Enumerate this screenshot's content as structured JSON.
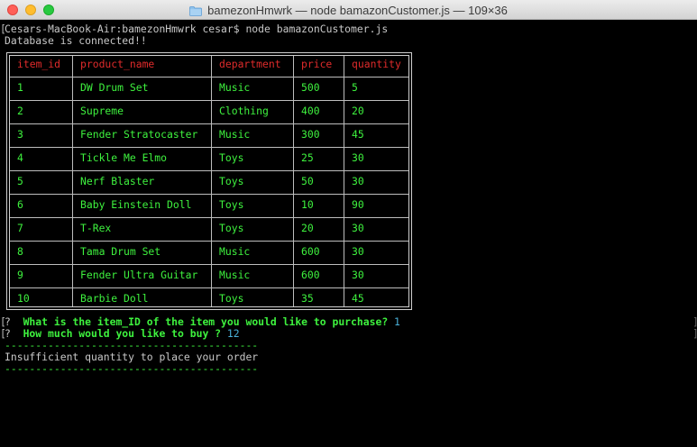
{
  "window": {
    "title": "bamezonHmwrk — node bamazonCustomer.js — 109×36"
  },
  "terminal": {
    "prompt_line": "Cesars-MacBook-Air:bamezonHmwrk cesar$ node bamazonCustomer.js",
    "connected_line": "Database is connected!!",
    "q1_marker": "?",
    "q1_text": "What is the item_ID of the item you would like to purchase?",
    "q1_answer": "1",
    "q2_marker": "?",
    "q2_text": "How much would you like to buy ?",
    "q2_answer": "12",
    "divider": "-----------------------------------------",
    "message": "Insufficient quantity to place your order"
  },
  "table": {
    "headers": [
      "item_id",
      "product_name",
      "department",
      "price",
      "quantity"
    ],
    "rows": [
      [
        "1",
        "DW Drum Set",
        "Music",
        "500",
        "5"
      ],
      [
        "2",
        "Supreme",
        "Clothing",
        "400",
        "20"
      ],
      [
        "3",
        "Fender Stratocaster",
        "Music",
        "300",
        "45"
      ],
      [
        "4",
        "Tickle Me Elmo",
        "Toys",
        "25",
        "30"
      ],
      [
        "5",
        "Nerf Blaster",
        "Toys",
        "50",
        "30"
      ],
      [
        "6",
        "Baby Einstein Doll",
        "Toys",
        "10",
        "90"
      ],
      [
        "7",
        "T-Rex",
        "Toys",
        "20",
        "30"
      ],
      [
        "8",
        "Tama Drum Set",
        "Music",
        "600",
        "30"
      ],
      [
        "9",
        "Fender Ultra Guitar",
        "Music",
        "600",
        "30"
      ],
      [
        "10",
        "Barbie Doll",
        "Toys",
        "35",
        "45"
      ]
    ]
  },
  "colors": {
    "terminal_bg": "#000000",
    "text_green": "#3ef23e",
    "header_red": "#e02b2b",
    "answer_blue": "#49b0d8",
    "border_gray": "#cfcfcf"
  },
  "icons": {
    "title_folder": "folder-icon"
  }
}
